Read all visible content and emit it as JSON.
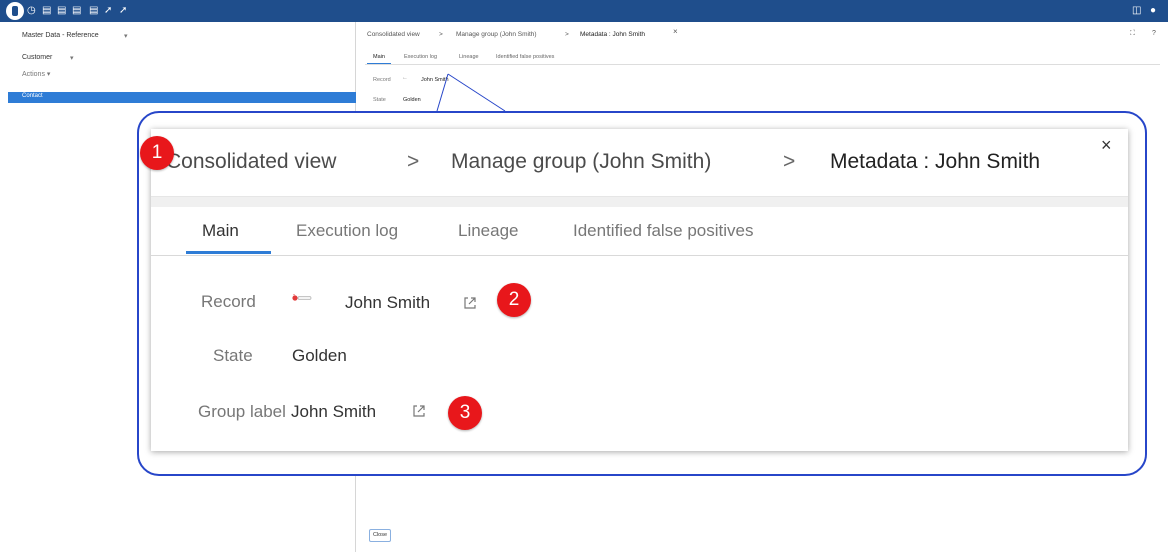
{
  "topbar": {
    "icons": [
      "app-logo",
      "clock-icon",
      "doc-icon",
      "doc-icon",
      "doc-icon",
      "pin-icon",
      "wand-icon",
      "book-icon",
      "user-icon"
    ]
  },
  "leftpanel": {
    "dataspace": "Master Data - Reference",
    "table": "Customer",
    "actions": "Actions ▾",
    "selected_row": "Contact"
  },
  "small_view": {
    "breadcrumbs": [
      "Consolidated view",
      "Manage group (John Smith)",
      "Metadata : John Smith"
    ],
    "separator": ">",
    "close": "×",
    "expand": "⛶",
    "help": "?",
    "tabs": [
      "Main",
      "Execution log",
      "Lineage",
      "Identified false positives"
    ],
    "record_label": "Record",
    "record_value": "John Smith",
    "state_label": "State",
    "state_value": "Golden",
    "close_button": "Close"
  },
  "zoom": {
    "breadcrumbs": [
      "Consolidated view",
      "Manage group (John Smith)",
      "Metadata : John Smith"
    ],
    "separator": ">",
    "close": "×",
    "tabs": [
      "Main",
      "Execution log",
      "Lineage",
      "Identified false positives"
    ],
    "active_tab": "Main",
    "fields": {
      "record_label": "Record",
      "record_value": "John Smith",
      "state_label": "State",
      "state_value": "Golden",
      "group_label": "Group label",
      "group_value": "John Smith"
    },
    "badges": [
      "1",
      "2",
      "3"
    ],
    "colors": {
      "accent": "#2e7cd6",
      "callout_border": "#2746c9",
      "badge": "#e8171b",
      "topbar": "#1f4e8c"
    }
  }
}
